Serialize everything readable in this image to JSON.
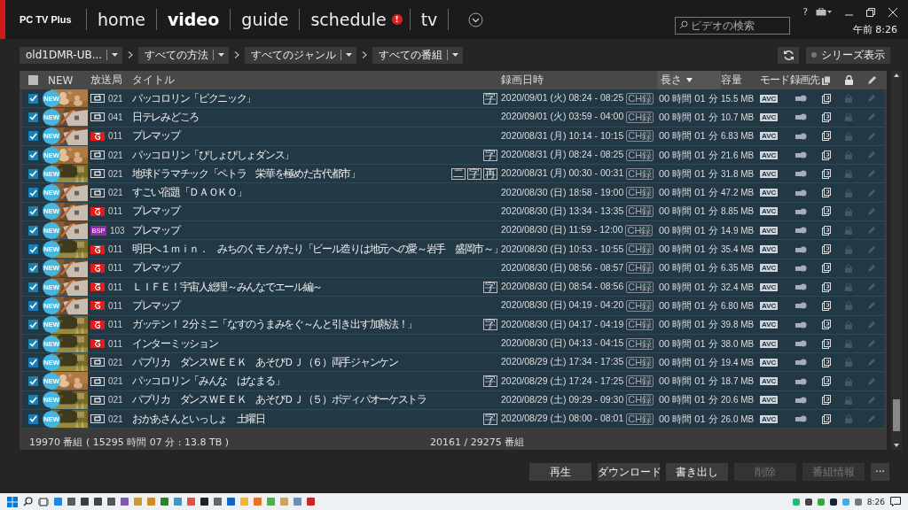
{
  "app": {
    "logo": "PC TV Plus"
  },
  "nav": [
    {
      "label": "home",
      "selected": false
    },
    {
      "label": "video",
      "selected": true
    },
    {
      "label": "guide",
      "selected": false
    },
    {
      "label": "schedule",
      "selected": false,
      "badge": "!"
    },
    {
      "label": "tv",
      "selected": false
    }
  ],
  "header_right": {
    "help": "?",
    "search_placeholder": "ビデオの検索",
    "clock": "午前 8:26"
  },
  "filters": [
    {
      "value": "old1DMR-UB..."
    },
    {
      "value": "すべての方法"
    },
    {
      "value": "すべてのジャンル"
    },
    {
      "value": "すべての番組"
    }
  ],
  "series_toggle": {
    "label": "シリーズ表示",
    "on": false
  },
  "table": {
    "header_checked": false,
    "columns": [
      {
        "kind": "new",
        "label": "NEW",
        "sorted": false
      },
      {
        "kind": "text",
        "label": "放送局",
        "sorted": false
      },
      {
        "kind": "text",
        "label": "タイトル",
        "sorted": false
      },
      {
        "kind": "text",
        "label": "録画日時",
        "sorted": false
      },
      {
        "kind": "text",
        "label": "長さ",
        "sorted": true
      },
      {
        "kind": "text",
        "label": "容量",
        "sorted": false
      },
      {
        "kind": "text",
        "label": "モード",
        "sorted": false
      },
      {
        "kind": "text",
        "label": "録画先",
        "sorted": false
      },
      {
        "kind": "copy",
        "sorted": false
      },
      {
        "kind": "lock",
        "sorted": false
      },
      {
        "kind": "edit",
        "sorted": false
      }
    ],
    "rows": [
      {
        "checked": true,
        "new": "NEW",
        "channel": {
          "kind": "outline",
          "number": "021"
        },
        "title": "パッコロリン「ピクニック」",
        "marks": [
          "字"
        ],
        "date": "2020/09/01 (火) 08:24 - 08:25",
        "rec": "CH録",
        "length": "00 時間 01 分",
        "size": "15.5 MB",
        "mode": "AVC"
      },
      {
        "checked": true,
        "new": "NEW",
        "channel": {
          "kind": "outline",
          "number": "041"
        },
        "title": "日テレみどころ",
        "date": "2020/09/01 (火) 03:59 - 04:00",
        "rec": "CH録",
        "length": "00 時間 01 分",
        "size": "10.7 MB",
        "mode": "AVC"
      },
      {
        "checked": true,
        "new": "NEW",
        "channel": {
          "kind": "red",
          "number": "011"
        },
        "title": "プレマップ",
        "date": "2020/08/31 (月) 10:14 - 10:15",
        "rec": "CH録",
        "length": "00 時間 01 分",
        "size": "6.83 MB",
        "mode": "AVC"
      },
      {
        "checked": true,
        "new": "NEW",
        "channel": {
          "kind": "outline",
          "number": "021"
        },
        "title": "パッコロリン「ぴしょぴしょダンス」",
        "marks": [
          "字"
        ],
        "date": "2020/08/31 (月) 08:24 - 08:25",
        "rec": "CH録",
        "length": "00 時間 01 分",
        "size": "21.6 MB",
        "mode": "AVC"
      },
      {
        "checked": true,
        "new": "NEW",
        "channel": {
          "kind": "outline",
          "number": "021"
        },
        "title": "地球ドラマチック「ペトラ　栄華を極めた古代都市」",
        "marks": [
          "二",
          "字",
          "再"
        ],
        "date": "2020/08/31 (月) 00:30 - 00:31",
        "rec": "CH録",
        "length": "00 時間 01 分",
        "size": "31.8 MB",
        "mode": "AVC"
      },
      {
        "checked": true,
        "new": "NEW",
        "channel": {
          "kind": "outline",
          "number": "021"
        },
        "title": "すごい宿題「ＤＡＯＫＯ」",
        "date": "2020/08/30 (日) 18:58 - 19:00",
        "rec": "CH録",
        "length": "00 時間 01 分",
        "size": "47.2 MB",
        "mode": "AVC"
      },
      {
        "checked": true,
        "new": "NEW",
        "channel": {
          "kind": "red",
          "number": "011"
        },
        "title": "プレマップ",
        "date": "2020/08/30 (日) 13:34 - 13:35",
        "rec": "CH録",
        "length": "00 時間 01 分",
        "size": "8.85 MB",
        "mode": "AVC"
      },
      {
        "checked": true,
        "new": "NEW",
        "channel": {
          "kind": "bsp",
          "badge": "BSP",
          "number": "103"
        },
        "title": "プレマップ",
        "date": "2020/08/30 (日) 11:59 - 12:00",
        "rec": "CH録",
        "length": "00 時間 01 分",
        "size": "14.9 MB",
        "mode": "AVC"
      },
      {
        "checked": true,
        "new": "NEW",
        "channel": {
          "kind": "red",
          "number": "011"
        },
        "title": "明日へ１ｍｉｎ．　みちのくモノがたり「ビール造りは地元への愛～岩手　盛岡市～」",
        "date": "2020/08/30 (日) 10:53 - 10:55",
        "rec": "CH録",
        "length": "00 時間 01 分",
        "size": "35.4 MB",
        "mode": "AVC"
      },
      {
        "checked": true,
        "new": "NEW",
        "channel": {
          "kind": "red",
          "number": "011"
        },
        "title": "プレマップ",
        "date": "2020/08/30 (日) 08:56 - 08:57",
        "rec": "CH録",
        "length": "00 時間 01 分",
        "size": "6.35 MB",
        "mode": "AVC"
      },
      {
        "checked": true,
        "new": "NEW",
        "channel": {
          "kind": "red",
          "number": "011"
        },
        "title": "ＬＩＦＥ！宇宙人総理～みんなでエール編～",
        "marks": [
          "字"
        ],
        "date": "2020/08/30 (日) 08:54 - 08:56",
        "rec": "CH録",
        "length": "00 時間 01 分",
        "size": "32.4 MB",
        "mode": "AVC"
      },
      {
        "checked": true,
        "new": "NEW",
        "channel": {
          "kind": "red",
          "number": "011"
        },
        "title": "プレマップ",
        "date": "2020/08/30 (日) 04:19 - 04:20",
        "rec": "CH録",
        "length": "00 時間 01 分",
        "size": "6.80 MB",
        "mode": "AVC"
      },
      {
        "checked": true,
        "new": "NEW",
        "channel": {
          "kind": "red",
          "number": "011"
        },
        "title": "ガッテン！２分ミニ「なすのうまみをぐ～んと引き出す加熱法！」",
        "marks": [
          "字"
        ],
        "date": "2020/08/30 (日) 04:17 - 04:19",
        "rec": "CH録",
        "length": "00 時間 01 分",
        "size": "39.8 MB",
        "mode": "AVC"
      },
      {
        "checked": true,
        "new": "NEW",
        "channel": {
          "kind": "red",
          "number": "011"
        },
        "title": "インターミッション",
        "date": "2020/08/30 (日) 04:13 - 04:15",
        "rec": "CH録",
        "length": "00 時間 01 分",
        "size": "38.0 MB",
        "mode": "AVC"
      },
      {
        "checked": true,
        "new": "NEW",
        "channel": {
          "kind": "outline",
          "number": "021"
        },
        "title": "パプリカ　ダンスＷＥＥＫ　あそびＤＪ（６）両手ジャンケン",
        "date": "2020/08/29 (土) 17:34 - 17:35",
        "rec": "CH録",
        "length": "00 時間 01 分",
        "size": "19.4 MB",
        "mode": "AVC"
      },
      {
        "checked": true,
        "new": "NEW",
        "channel": {
          "kind": "outline",
          "number": "021"
        },
        "title": "パッコロリン「みんな　はなまる」",
        "marks": [
          "字"
        ],
        "date": "2020/08/29 (土) 17:24 - 17:25",
        "rec": "CH録",
        "length": "00 時間 01 分",
        "size": "18.7 MB",
        "mode": "AVC"
      },
      {
        "checked": true,
        "new": "NEW",
        "channel": {
          "kind": "outline",
          "number": "021"
        },
        "title": "パプリカ　ダンスＷＥＥＫ　あそびＤＪ（５）ボディパオーケストラ",
        "date": "2020/08/29 (土) 09:29 - 09:30",
        "rec": "CH録",
        "length": "00 時間 01 分",
        "size": "20.6 MB",
        "mode": "AVC"
      },
      {
        "checked": true,
        "new": "NEW",
        "channel": {
          "kind": "outline",
          "number": "021"
        },
        "title": "おかあさんといっしょ　土曜日",
        "marks": [
          "字"
        ],
        "date": "2020/08/29 (土) 08:00 - 08:01",
        "rec": "CH録",
        "length": "00 時間 01 分",
        "size": "26.0 MB",
        "mode": "AVC"
      }
    ],
    "footer_total": "19970 番組 ( 15295 時間 07 分 : 13.8 TB )",
    "footer_count": "20161 / 29275 番組"
  },
  "actions": [
    {
      "label": "再生",
      "disabled": false
    },
    {
      "label": "ダウンロード",
      "disabled": false
    },
    {
      "label": "書き出し",
      "disabled": false
    },
    {
      "label": "削除",
      "disabled": true
    },
    {
      "label": "番組情報",
      "disabled": true
    }
  ],
  "more_button": "···",
  "taskbar": {
    "time": "8:26"
  }
}
